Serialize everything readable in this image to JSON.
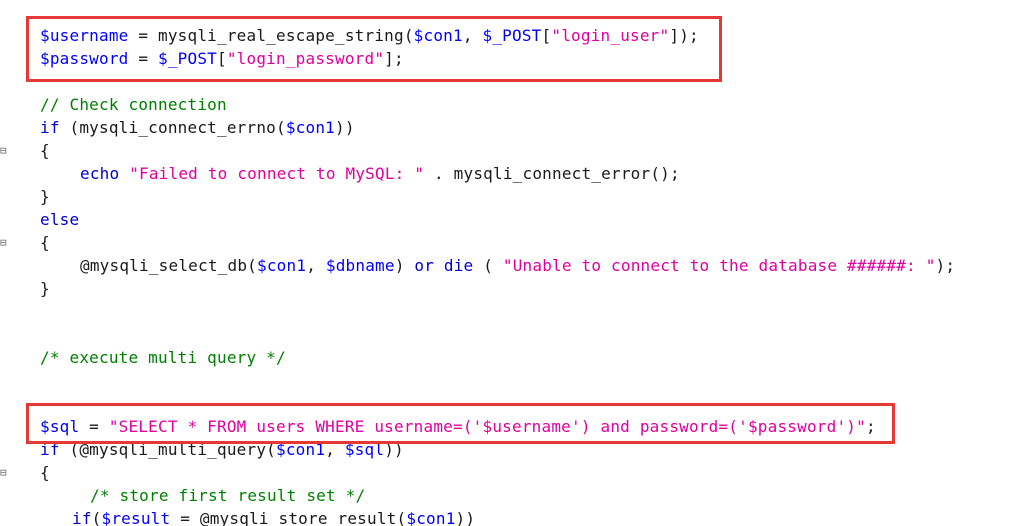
{
  "editor": {
    "lines": [
      {
        "parts": [
          {
            "t": "$username",
            "c": "var"
          },
          {
            "t": " = ",
            "c": "punc"
          },
          {
            "t": "mysqli_real_escape_string",
            "c": "fn"
          },
          {
            "t": "(",
            "c": "punc"
          },
          {
            "t": "$con1",
            "c": "var"
          },
          {
            "t": ", ",
            "c": "punc"
          },
          {
            "t": "$_POST",
            "c": "var"
          },
          {
            "t": "[",
            "c": "punc"
          },
          {
            "t": "\"login_user\"",
            "c": "str"
          },
          {
            "t": "]);",
            "c": "punc"
          }
        ]
      },
      {
        "parts": [
          {
            "t": "$password",
            "c": "var"
          },
          {
            "t": " = ",
            "c": "punc"
          },
          {
            "t": "$_POST",
            "c": "var"
          },
          {
            "t": "[",
            "c": "punc"
          },
          {
            "t": "\"login_password\"",
            "c": "str"
          },
          {
            "t": "];",
            "c": "punc"
          }
        ]
      },
      {
        "parts": []
      },
      {
        "parts": [
          {
            "t": "// Check connection",
            "c": "comment"
          }
        ]
      },
      {
        "parts": [
          {
            "t": "if",
            "c": "kw"
          },
          {
            "t": " (",
            "c": "punc"
          },
          {
            "t": "mysqli_connect_errno",
            "c": "fn"
          },
          {
            "t": "(",
            "c": "punc"
          },
          {
            "t": "$con1",
            "c": "var"
          },
          {
            "t": "))",
            "c": "punc"
          }
        ]
      },
      {
        "parts": [
          {
            "t": "{",
            "c": "punc"
          }
        ]
      },
      {
        "parts": [
          {
            "t": "echo",
            "c": "kw"
          },
          {
            "t": " ",
            "c": "punc"
          },
          {
            "t": "\"Failed to connect to MySQL: \"",
            "c": "str"
          },
          {
            "t": " . ",
            "c": "punc"
          },
          {
            "t": "mysqli_connect_error",
            "c": "fn"
          },
          {
            "t": "();",
            "c": "punc"
          }
        ]
      },
      {
        "parts": [
          {
            "t": "}",
            "c": "punc"
          }
        ]
      },
      {
        "parts": [
          {
            "t": "else",
            "c": "kw"
          }
        ]
      },
      {
        "parts": [
          {
            "t": "{",
            "c": "punc"
          }
        ]
      },
      {
        "parts": [
          {
            "t": "@mysqli_select_db",
            "c": "fn"
          },
          {
            "t": "(",
            "c": "punc"
          },
          {
            "t": "$con1",
            "c": "var"
          },
          {
            "t": ", ",
            "c": "punc"
          },
          {
            "t": "$dbname",
            "c": "var"
          },
          {
            "t": ") ",
            "c": "punc"
          },
          {
            "t": "or",
            "c": "kw"
          },
          {
            "t": " ",
            "c": "punc"
          },
          {
            "t": "die",
            "c": "kw"
          },
          {
            "t": " ( ",
            "c": "punc"
          },
          {
            "t": "\"Unable to connect to the database ######: \"",
            "c": "str"
          },
          {
            "t": ");",
            "c": "punc"
          }
        ]
      },
      {
        "parts": [
          {
            "t": "}",
            "c": "punc"
          }
        ]
      },
      {
        "parts": []
      },
      {
        "parts": []
      },
      {
        "parts": [
          {
            "t": "/* execute multi query */",
            "c": "comment"
          }
        ]
      },
      {
        "parts": []
      },
      {
        "parts": []
      },
      {
        "parts": [
          {
            "t": "$sql",
            "c": "var"
          },
          {
            "t": " = ",
            "c": "punc"
          },
          {
            "t": "\"SELECT * FROM users WHERE username=('$username') and password=('$password')\"",
            "c": "str"
          },
          {
            "t": ";",
            "c": "punc"
          }
        ]
      },
      {
        "parts": [
          {
            "t": "if",
            "c": "kw"
          },
          {
            "t": " (",
            "c": "punc"
          },
          {
            "t": "@mysqli_multi_query",
            "c": "fn"
          },
          {
            "t": "(",
            "c": "punc"
          },
          {
            "t": "$con1",
            "c": "var"
          },
          {
            "t": ", ",
            "c": "punc"
          },
          {
            "t": "$sql",
            "c": "var"
          },
          {
            "t": "))",
            "c": "punc"
          }
        ]
      },
      {
        "parts": [
          {
            "t": "{",
            "c": "punc"
          }
        ]
      },
      {
        "parts": [
          {
            "t": "/* store first result set */",
            "c": "comment"
          }
        ]
      },
      {
        "parts": [
          {
            "t": "if",
            "c": "kw"
          },
          {
            "t": "(",
            "c": "punc"
          },
          {
            "t": "$result",
            "c": "var"
          },
          {
            "t": " = ",
            "c": "punc"
          },
          {
            "t": "@mysqli_store_result",
            "c": "fn"
          },
          {
            "t": "(",
            "c": "punc"
          },
          {
            "t": "$con1",
            "c": "var"
          },
          {
            "t": "))",
            "c": "punc"
          }
        ]
      }
    ],
    "fold_markers": {
      "markers": [
        "⊟",
        "⊟",
        "⊟"
      ]
    },
    "highlight_boxes": {
      "colors": [
        "#e53935"
      ]
    }
  }
}
